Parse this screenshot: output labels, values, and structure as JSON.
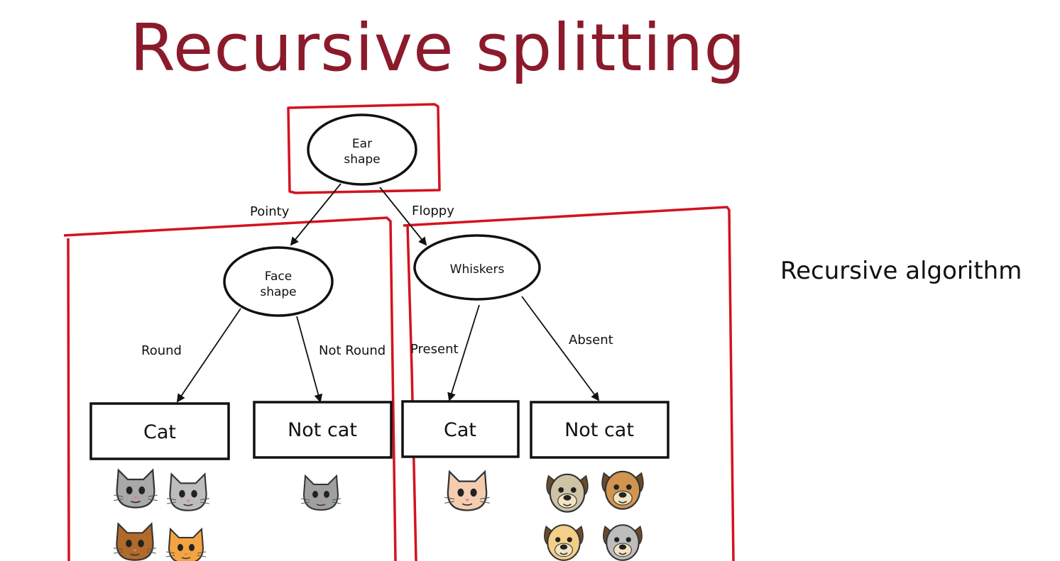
{
  "title": "Recursive splitting",
  "side_text": "Recursive algorithm",
  "colors": {
    "title": "#8b1a2b",
    "highlight": "#d4121f",
    "ink": "#111111"
  },
  "tree": {
    "root": {
      "label_line1": "Ear",
      "label_line2": "shape"
    },
    "edges": {
      "pointy": "Pointy",
      "floppy": "Floppy",
      "round": "Round",
      "not_round": "Not Round",
      "present": "Present",
      "absent": "Absent"
    },
    "face_node": {
      "label_line1": "Face",
      "label_line2": "shape"
    },
    "whiskers_node": {
      "label": "Whiskers"
    },
    "leaves": {
      "left_cat": "Cat",
      "left_not_cat": "Not cat",
      "right_cat": "Cat",
      "right_not_cat": "Not cat"
    }
  },
  "icons": {
    "left_cat": [
      "gray-cat-smiling-icon",
      "gray-cat-icon",
      "brown-cat-icon",
      "orange-cat-icon"
    ],
    "left_not_cat": [
      "gray-cat-pointy-face-icon"
    ],
    "right_cat": [
      "floppy-ear-cat-icon"
    ],
    "right_not_cat": [
      "pug-dog-icon",
      "brown-dog-icon",
      "yellow-dog-icon",
      "gray-dog-icon"
    ]
  }
}
